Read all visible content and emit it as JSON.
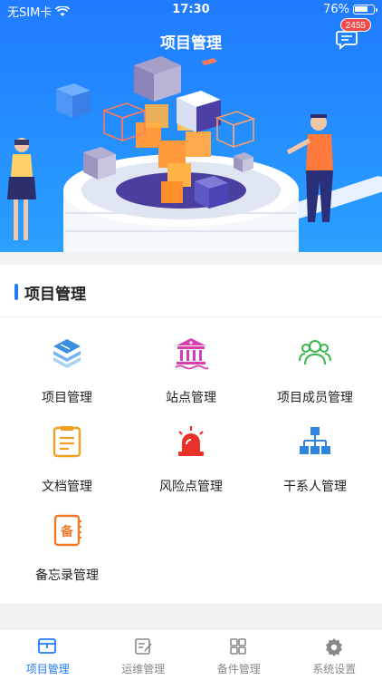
{
  "status_bar": {
    "carrier": "无SIM卡",
    "time": "17:30",
    "battery": "76%",
    "battery_level": 0.76
  },
  "header": {
    "title": "项目管理",
    "message_badge": "2455"
  },
  "section": {
    "title": "项目管理"
  },
  "tiles": [
    {
      "label": "项目管理",
      "icon": "layers-icon",
      "color": "#3a8fe0"
    },
    {
      "label": "站点管理",
      "icon": "building-icon",
      "color": "#d63fb0"
    },
    {
      "label": "项目成员管理",
      "icon": "people-icon",
      "color": "#3bb54a"
    },
    {
      "label": "文档管理",
      "icon": "document-icon",
      "color": "#f0a020"
    },
    {
      "label": "风险点管理",
      "icon": "alarm-light-icon",
      "color": "#e8322a"
    },
    {
      "label": "干系人管理",
      "icon": "org-chart-icon",
      "color": "#2f86e0"
    },
    {
      "label": "备忘录管理",
      "icon": "memo-book-icon",
      "color": "#f07a2a"
    }
  ],
  "tabbar": [
    {
      "label": "项目管理",
      "icon": "project-icon",
      "active": true
    },
    {
      "label": "运维管理",
      "icon": "edit-note-icon",
      "active": false
    },
    {
      "label": "备件管理",
      "icon": "grid-icon",
      "active": false
    },
    {
      "label": "系统设置",
      "icon": "gear-icon",
      "active": false
    }
  ],
  "colors": {
    "accent": "#1f7bff",
    "badge": "#f14c4c"
  }
}
